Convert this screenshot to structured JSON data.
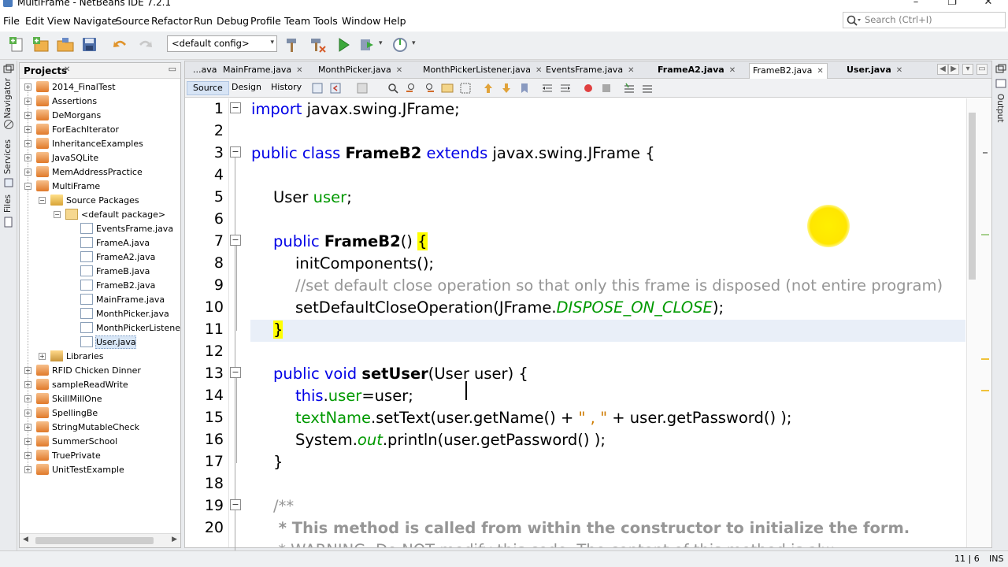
{
  "window": {
    "title": "MultiFrame - NetBeans IDE 7.2.1",
    "minimize": "–",
    "maximize": "❐",
    "close": "✕"
  },
  "menu": [
    "File",
    "Edit",
    "View",
    "Navigate",
    "Source",
    "Refactor",
    "Run",
    "Debug",
    "Profile",
    "Team",
    "Tools",
    "Window",
    "Help"
  ],
  "search": {
    "placeholder": "Search (Ctrl+I)"
  },
  "toolbar": {
    "config": "<default config>",
    "config_arrow": "▾"
  },
  "side_tabs": {
    "navigator": "Navigator",
    "services": "Services",
    "files": "Files",
    "output": "Output"
  },
  "projects": {
    "title": "Projects",
    "close": "✕",
    "minimize": "▭",
    "items": [
      {
        "label": "2014_FinalTest",
        "toggle": "+",
        "type": "proj"
      },
      {
        "label": "Assertions",
        "toggle": "+",
        "type": "proj"
      },
      {
        "label": "DeMorgans",
        "toggle": "+",
        "type": "proj"
      },
      {
        "label": "ForEachIterator",
        "toggle": "+",
        "type": "proj"
      },
      {
        "label": "InheritanceExamples",
        "toggle": "+",
        "type": "proj"
      },
      {
        "label": "JavaSQLite",
        "toggle": "+",
        "type": "proj"
      },
      {
        "label": "MemAddressPractice",
        "toggle": "+",
        "type": "proj"
      },
      {
        "label": "MultiFrame",
        "toggle": "−",
        "type": "proj"
      },
      {
        "label": "Source Packages",
        "toggle": "−",
        "type": "pkgf"
      },
      {
        "label": "<default package>",
        "toggle": "−",
        "type": "pkg"
      },
      {
        "label": "EventsFrame.java",
        "toggle": "",
        "type": "java"
      },
      {
        "label": "FrameA.java",
        "toggle": "",
        "type": "java"
      },
      {
        "label": "FrameA2.java",
        "toggle": "",
        "type": "java"
      },
      {
        "label": "FrameB.java",
        "toggle": "",
        "type": "java"
      },
      {
        "label": "FrameB2.java",
        "toggle": "",
        "type": "java"
      },
      {
        "label": "MainFrame.java",
        "toggle": "",
        "type": "java"
      },
      {
        "label": "MonthPicker.java",
        "toggle": "",
        "type": "java"
      },
      {
        "label": "MonthPickerListener.j",
        "toggle": "",
        "type": "java"
      },
      {
        "label": "User.java",
        "toggle": "",
        "type": "java"
      },
      {
        "label": "Libraries",
        "toggle": "+",
        "type": "lib"
      },
      {
        "label": "RFID Chicken Dinner",
        "toggle": "+",
        "type": "proj"
      },
      {
        "label": "sampleReadWrite",
        "toggle": "+",
        "type": "proj"
      },
      {
        "label": "SkillMillOne",
        "toggle": "+",
        "type": "proj"
      },
      {
        "label": "SpellingBe",
        "toggle": "+",
        "type": "proj"
      },
      {
        "label": "StringMutableCheck",
        "toggle": "+",
        "type": "proj"
      },
      {
        "label": "SummerSchool",
        "toggle": "+",
        "type": "proj"
      },
      {
        "label": "TruePrivate",
        "toggle": "+",
        "type": "proj"
      },
      {
        "label": "UnitTestExample",
        "toggle": "+",
        "type": "proj"
      }
    ],
    "scroll_left": "◀",
    "scroll_right": "▶"
  },
  "tabs": [
    {
      "label": "...ava",
      "close": ""
    },
    {
      "label": "MainFrame.java",
      "close": "✕"
    },
    {
      "label": "MonthPicker.java",
      "close": "✕"
    },
    {
      "label": "MonthPickerListener.java",
      "close": "✕"
    },
    {
      "label": "EventsFrame.java",
      "close": "✕"
    },
    {
      "label": "FrameA2.java",
      "close": "✕"
    },
    {
      "label": "FrameB2.java",
      "close": "✕"
    },
    {
      "label": "User.java",
      "close": "✕"
    }
  ],
  "editor_tabs": {
    "source": "Source",
    "design": "Design",
    "history": "History"
  },
  "tab_nav": {
    "left": "◀",
    "right": "▶",
    "down": "▾",
    "restore": "▭"
  },
  "line_numbers": [
    "1",
    "2",
    "3",
    "4",
    "5",
    "6",
    "7",
    "8",
    "9",
    "10",
    "11",
    "12",
    "13",
    "14",
    "15",
    "16",
    "17",
    "18",
    "19",
    "20"
  ],
  "code": {
    "l1_kw": "import",
    "l1_rest": " javax.swing.JFrame;",
    "l3_kw1": "public class",
    "l3_name": "FrameB2",
    "l3_kw2": "extends",
    "l3_rest": " javax.swing.JFrame",
    "l3_brace": "{",
    "l5_type": "User",
    "l5_field": "user",
    "l5_semi": ";",
    "l7_kw": "public",
    "l7_name": "FrameB2",
    "l7_parens": "()",
    "l7_brace": "{",
    "l8": "initComponents();",
    "l9": "//set default close operation so that only this frame is disposed (not entire program)",
    "l10_a": "setDefaultCloseOperation(JFrame.",
    "l10_const": "DISPOSE_ON_CLOSE",
    "l10_b": ");",
    "l11": "}",
    "l13_kw": "public void",
    "l13_name": "setUser",
    "l13_rest": "(User user) {",
    "l14_kw": "this",
    "l14_dot": ".",
    "l14_field": "user",
    "l14_rest": "=user;",
    "l15_field": "textName",
    "l15_a": ".setText(user.getName() + ",
    "l15_str": "\" , \"",
    "l15_b": " + user.getPassword() );",
    "l16_a": "System.",
    "l16_out": "out",
    "l16_b": ".println(user.getPassword() );",
    "l17": "}",
    "l19": "/**",
    "l20": " * This method is called from within the constructor to initialize the form.",
    "l21": " * WARNING: Do NOT modify this code. The content of this method is alw"
  },
  "fold_marks": {
    "minus": "−"
  },
  "status": {
    "position": "11 | 6",
    "mode": "INS"
  }
}
